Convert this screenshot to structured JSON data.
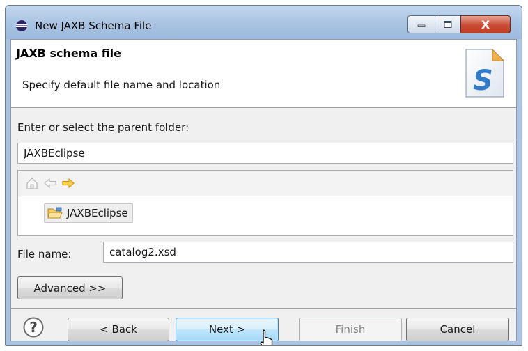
{
  "window": {
    "title": "New JAXB Schema File",
    "controls": {
      "minimize": "minimize",
      "maximize": "maximize",
      "close": "X"
    }
  },
  "banner": {
    "title": "JAXB schema file",
    "description": "Specify default file name and location",
    "icon": "schema-s-icon"
  },
  "parent_folder": {
    "label": "Enter or select the parent folder:",
    "value": "JAXBEclipse"
  },
  "tree": {
    "toolbar": [
      "home-icon",
      "back-arrow-icon",
      "forward-arrow-icon"
    ],
    "items": [
      {
        "label": "JAXBEclipse",
        "icon": "open-folder-icon",
        "selected": true
      }
    ]
  },
  "file_name": {
    "label": "File name:",
    "value": "catalog2.xsd"
  },
  "buttons": {
    "advanced": "Advanced >>",
    "back": "< Back",
    "next": "Next >",
    "finish": "Finish",
    "cancel": "Cancel"
  },
  "colors": {
    "title_bar": "#a9c4e2",
    "close_button": "#c94a33",
    "default_button": "#bee6fd"
  }
}
